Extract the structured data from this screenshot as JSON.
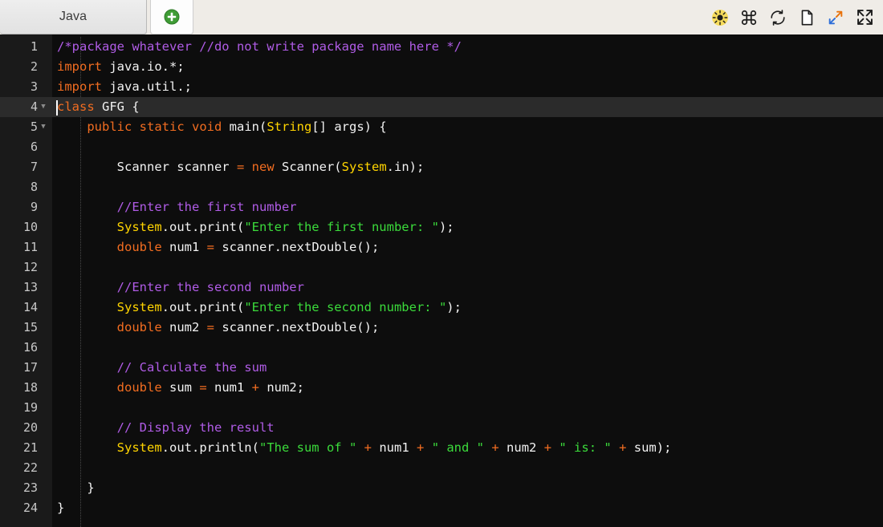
{
  "tabs": {
    "items": [
      {
        "label": "Java",
        "active": true
      }
    ],
    "add_label": "+",
    "add_icon": "plus-circle-icon"
  },
  "toolbar": {
    "icons": [
      {
        "name": "brightness-icon",
        "title": "Brightness",
        "color": "#f5d742"
      },
      {
        "name": "command-icon",
        "title": "Shortcuts",
        "color": "#1c1c1c"
      },
      {
        "name": "refresh-icon",
        "title": "Reset",
        "color": "#1c1c1c"
      },
      {
        "name": "page-icon",
        "title": "New file",
        "color": "#1c1c1c"
      },
      {
        "name": "resize-diagonal-icon",
        "title": "Resize",
        "color": "#2e6fd9"
      },
      {
        "name": "fullscreen-icon",
        "title": "Fullscreen",
        "color": "#1c1c1c"
      }
    ]
  },
  "editor": {
    "language": "Java",
    "active_line": 4,
    "background": "#0d0d0d",
    "gutter_background": "#1a1a1a",
    "active_line_background": "#2b2b2b",
    "colors": {
      "comment": "#b05ce6",
      "keyword": "#f26d21",
      "type": "#ffd400",
      "string": "#3bdb3b",
      "plain": "#f2f2f2",
      "line_number": "#c8c8c8"
    },
    "lines": [
      {
        "n": 1,
        "fold": false,
        "text": "/*package whatever //do not write package name here */"
      },
      {
        "n": 2,
        "fold": false,
        "text": "import java.io.*;"
      },
      {
        "n": 3,
        "fold": false,
        "text": "import java.util.;"
      },
      {
        "n": 4,
        "fold": true,
        "text": "class GFG {"
      },
      {
        "n": 5,
        "fold": true,
        "text": "    public static void main(String[] args) {"
      },
      {
        "n": 6,
        "fold": false,
        "text": ""
      },
      {
        "n": 7,
        "fold": false,
        "text": "        Scanner scanner = new Scanner(System.in);"
      },
      {
        "n": 8,
        "fold": false,
        "text": ""
      },
      {
        "n": 9,
        "fold": false,
        "text": "        //Enter the first number"
      },
      {
        "n": 10,
        "fold": false,
        "text": "        System.out.print(\"Enter the first number: \");"
      },
      {
        "n": 11,
        "fold": false,
        "text": "        double num1 = scanner.nextDouble();"
      },
      {
        "n": 12,
        "fold": false,
        "text": ""
      },
      {
        "n": 13,
        "fold": false,
        "text": "        //Enter the second number"
      },
      {
        "n": 14,
        "fold": false,
        "text": "        System.out.print(\"Enter the second number: \");"
      },
      {
        "n": 15,
        "fold": false,
        "text": "        double num2 = scanner.nextDouble();"
      },
      {
        "n": 16,
        "fold": false,
        "text": ""
      },
      {
        "n": 17,
        "fold": false,
        "text": "        // Calculate the sum"
      },
      {
        "n": 18,
        "fold": false,
        "text": "        double sum = num1 + num2;"
      },
      {
        "n": 19,
        "fold": false,
        "text": ""
      },
      {
        "n": 20,
        "fold": false,
        "text": "        // Display the result"
      },
      {
        "n": 21,
        "fold": false,
        "text": "        System.out.println(\"The sum of \" + num1 + \" and \" + num2 + \" is: \" + sum);"
      },
      {
        "n": 22,
        "fold": false,
        "text": ""
      },
      {
        "n": 23,
        "fold": false,
        "text": "    }"
      },
      {
        "n": 24,
        "fold": false,
        "text": "}"
      }
    ],
    "tokens": [
      [
        [
          "/*package whatever //do not write package name here */",
          "com"
        ]
      ],
      [
        [
          "import",
          "kw"
        ],
        [
          " java.io.*;",
          "pln"
        ]
      ],
      [
        [
          "import",
          "kw"
        ],
        [
          " java.util.;",
          "pln"
        ]
      ],
      [
        [
          "class",
          "kw"
        ],
        [
          " GFG {",
          "pln"
        ]
      ],
      [
        [
          "    ",
          "pln"
        ],
        [
          "public",
          "kw"
        ],
        [
          " ",
          "pln"
        ],
        [
          "static",
          "kw"
        ],
        [
          " ",
          "pln"
        ],
        [
          "void",
          "kw"
        ],
        [
          " main(",
          "pln"
        ],
        [
          "String",
          "type"
        ],
        [
          "[] args) {",
          "pln"
        ]
      ],
      [],
      [
        [
          "        Scanner scanner ",
          "pln"
        ],
        [
          "=",
          "op"
        ],
        [
          " ",
          "pln"
        ],
        [
          "new",
          "kw"
        ],
        [
          " Scanner(",
          "pln"
        ],
        [
          "System",
          "type"
        ],
        [
          ".in);",
          "pln"
        ]
      ],
      [],
      [
        [
          "        //Enter the first number",
          "com"
        ]
      ],
      [
        [
          "        ",
          "pln"
        ],
        [
          "System",
          "type"
        ],
        [
          ".out.print(",
          "pln"
        ],
        [
          "\"Enter the first number: \"",
          "str"
        ],
        [
          ");",
          "pln"
        ]
      ],
      [
        [
          "        ",
          "pln"
        ],
        [
          "double",
          "kw"
        ],
        [
          " num1 ",
          "pln"
        ],
        [
          "=",
          "op"
        ],
        [
          " scanner.nextDouble();",
          "pln"
        ]
      ],
      [],
      [
        [
          "        //Enter the second number",
          "com"
        ]
      ],
      [
        [
          "        ",
          "pln"
        ],
        [
          "System",
          "type"
        ],
        [
          ".out.print(",
          "pln"
        ],
        [
          "\"Enter the second number: \"",
          "str"
        ],
        [
          ");",
          "pln"
        ]
      ],
      [
        [
          "        ",
          "pln"
        ],
        [
          "double",
          "kw"
        ],
        [
          " num2 ",
          "pln"
        ],
        [
          "=",
          "op"
        ],
        [
          " scanner.nextDouble();",
          "pln"
        ]
      ],
      [],
      [
        [
          "        // Calculate the sum",
          "com"
        ]
      ],
      [
        [
          "        ",
          "pln"
        ],
        [
          "double",
          "kw"
        ],
        [
          " sum ",
          "pln"
        ],
        [
          "=",
          "op"
        ],
        [
          " num1 ",
          "pln"
        ],
        [
          "+",
          "op"
        ],
        [
          " num2;",
          "pln"
        ]
      ],
      [],
      [
        [
          "        // Display the result",
          "com"
        ]
      ],
      [
        [
          "        ",
          "pln"
        ],
        [
          "System",
          "type"
        ],
        [
          ".out.println(",
          "pln"
        ],
        [
          "\"The sum of \"",
          "str"
        ],
        [
          " ",
          "pln"
        ],
        [
          "+",
          "op"
        ],
        [
          " num1 ",
          "pln"
        ],
        [
          "+",
          "op"
        ],
        [
          " ",
          "pln"
        ],
        [
          "\" and \"",
          "str"
        ],
        [
          " ",
          "pln"
        ],
        [
          "+",
          "op"
        ],
        [
          " num2 ",
          "pln"
        ],
        [
          "+",
          "op"
        ],
        [
          " ",
          "pln"
        ],
        [
          "\" is: \"",
          "str"
        ],
        [
          " ",
          "pln"
        ],
        [
          "+",
          "op"
        ],
        [
          " sum);",
          "pln"
        ]
      ],
      [],
      [
        [
          "    }",
          "pln"
        ]
      ],
      [
        [
          "}",
          "pln"
        ]
      ]
    ]
  }
}
